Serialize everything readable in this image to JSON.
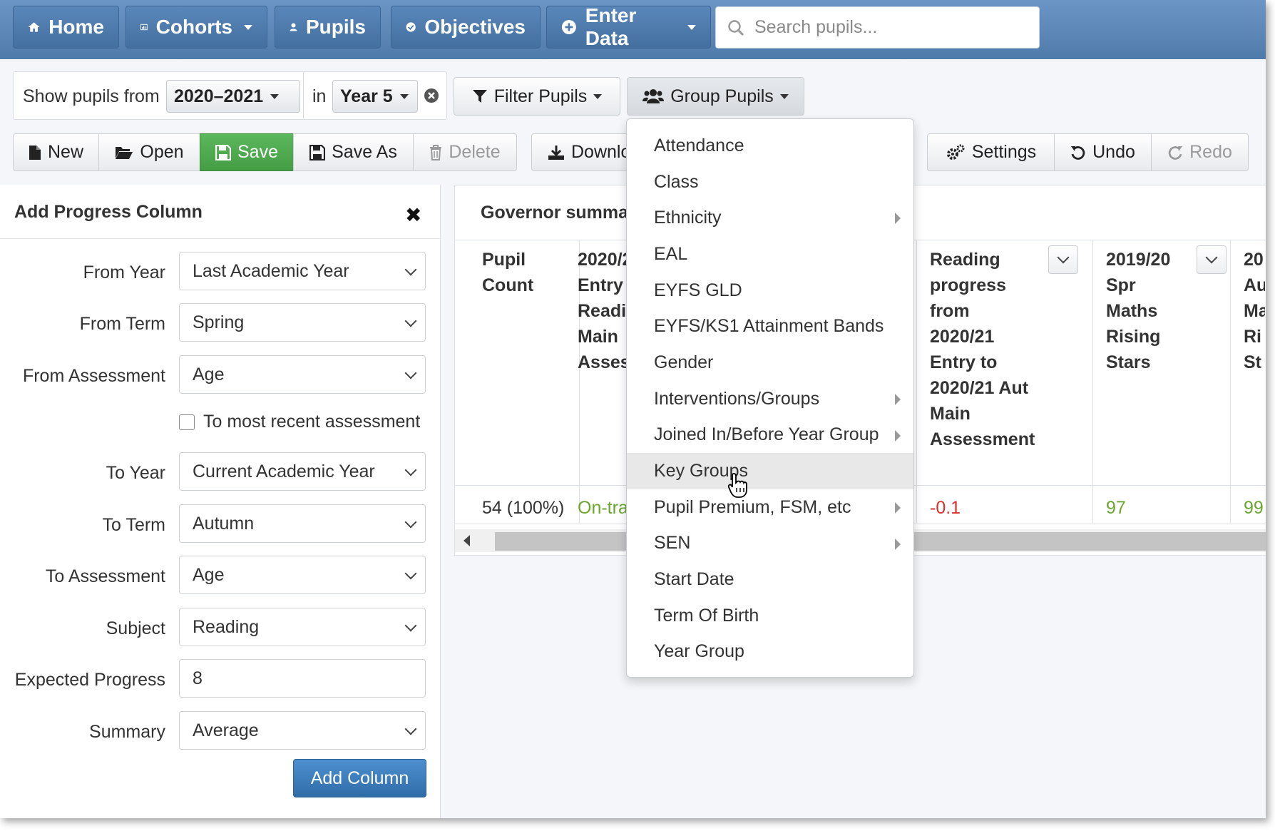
{
  "nav": {
    "home": "Home",
    "cohorts": "Cohorts",
    "pupils": "Pupils",
    "objectives": "Objectives",
    "enter_data": "Enter Data",
    "search_placeholder": "Search pupils..."
  },
  "filters": {
    "show_label": "Show pupils from",
    "year_value": "2020–2021",
    "in_label": "in",
    "group_value": "Year 5",
    "filter_button": "Filter Pupils",
    "group_button": "Group Pupils"
  },
  "toolbar": {
    "new": "New",
    "open": "Open",
    "save": "Save",
    "save_as": "Save As",
    "delete": "Delete",
    "download": "Downlo",
    "settings": "Settings",
    "undo": "Undo",
    "redo": "Redo"
  },
  "add_progress": {
    "title": "Add Progress Column",
    "from_year_label": "From Year",
    "from_year": "Last Academic Year",
    "from_term_label": "From Term",
    "from_term": "Spring",
    "from_assessment_label": "From Assessment",
    "from_assessment": "Age",
    "checkbox_label": "To most recent assessment",
    "to_year_label": "To Year",
    "to_year": "Current Academic Year",
    "to_term_label": "To Term",
    "to_term": "Autumn",
    "to_assessment_label": "To Assessment",
    "to_assessment": "Age",
    "subject_label": "Subject",
    "subject": "Reading",
    "expected_label": "Expected Progress",
    "expected_value": "8",
    "summary_label": "Summary",
    "summary": "Average",
    "add_button": "Add Column"
  },
  "governor": {
    "title": "Governor summa",
    "columns": [
      {
        "l1": "Pupil",
        "l2": "Count"
      },
      {
        "l1": "2020/2",
        "l2": "Entry",
        "l3": "Readi",
        "l4": "Main",
        "l5": "Asses"
      },
      {
        "l1": "Reading",
        "l2": "progress",
        "l3": "from",
        "l4": "2020/21",
        "l5": "Entry to",
        "l6": "2020/21 Aut",
        "l7": "Main",
        "l8": "Assessment"
      },
      {
        "l1": "2019/20",
        "l2": "Spr",
        "l3": "Maths",
        "l4": "Rising",
        "l5": "Stars"
      },
      {
        "l1": "20",
        "l2": "Au",
        "l3": "Ma",
        "l4": "Ri",
        "l5": "St"
      }
    ],
    "row": {
      "count": "54 (100%)",
      "entry": "On-trac",
      "progress": "-0.1",
      "maths": "97",
      "next": "99"
    }
  },
  "group_menu": {
    "items": [
      "Attendance",
      "Class",
      "Ethnicity",
      "EAL",
      "EYFS GLD",
      "EYFS/KS1 Attainment Bands",
      "Gender",
      "Interventions/Groups",
      "Joined In/Before Year Group",
      "Key Groups",
      "Pupil Premium, FSM, etc",
      "SEN",
      "Start Date",
      "Term Of Birth",
      "Year Group"
    ],
    "hovered": "Key Groups"
  },
  "colors": {
    "nav": "#5683b5",
    "save": "#4cae4c",
    "primary": "#3a7abd",
    "positive": "#6aa62e",
    "negative": "#d9302b"
  }
}
